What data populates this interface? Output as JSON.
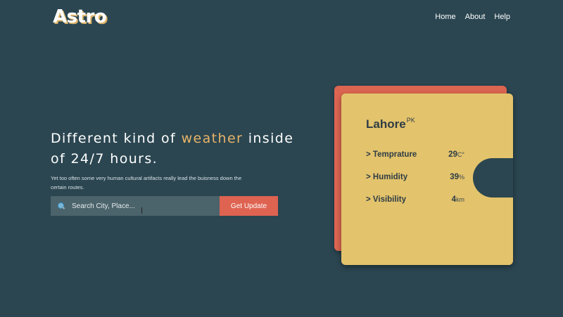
{
  "header": {
    "logo": "Astro",
    "nav": [
      "Home",
      "About",
      "Help"
    ]
  },
  "hero": {
    "headline_part1": "Different kind of ",
    "headline_highlight": "weather",
    "headline_part2": " inside of 24/7 hours.",
    "subtext": "Yet too often some very human cultural artifacts really lead the buisness down the certain routes."
  },
  "search": {
    "placeholder": "Search City, Place...",
    "value": "",
    "button_label": "Get Update"
  },
  "weather_card": {
    "city": "Lahore",
    "country": "PK",
    "rows": [
      {
        "label": "> Temprature",
        "value": "29",
        "unit": "C°"
      },
      {
        "label": "> Humidity",
        "value": "39",
        "unit": "%"
      },
      {
        "label": "> Visibility",
        "value": "4",
        "unit": "km"
      }
    ]
  },
  "colors": {
    "background": "#2b4651",
    "accent": "#e9b368",
    "button": "#df6351",
    "card": "#e3c36c",
    "card_back": "#dc6551"
  }
}
